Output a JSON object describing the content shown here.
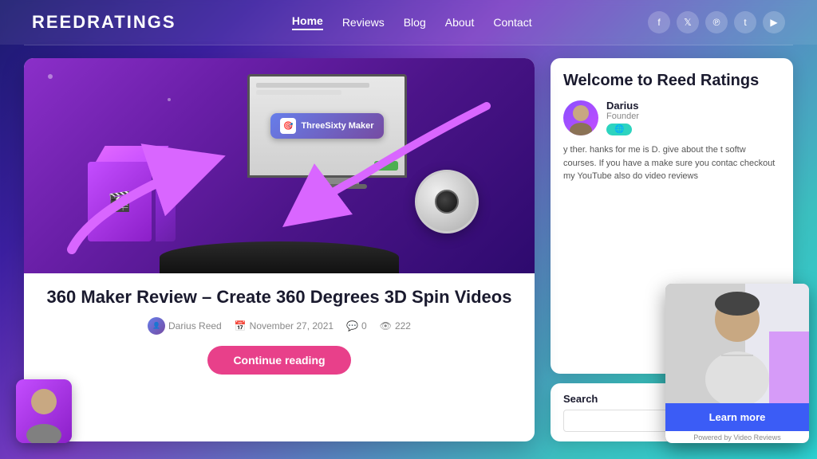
{
  "header": {
    "logo": "ReedRatings",
    "nav": {
      "items": [
        {
          "label": "Home",
          "active": true
        },
        {
          "label": "Reviews",
          "active": false
        },
        {
          "label": "Blog",
          "active": false
        },
        {
          "label": "About",
          "active": false
        },
        {
          "label": "Contact",
          "active": false
        }
      ]
    },
    "social": {
      "icons": [
        "f",
        "t",
        "p",
        "t",
        "yt"
      ]
    }
  },
  "article": {
    "title": "360 Maker Review – Create 360 Degrees 3D Spin Videos",
    "meta": {
      "author": "Darius Reed",
      "date": "November 27, 2021",
      "comments": "0",
      "views": "222"
    },
    "continue_reading": "Continue reading"
  },
  "sidebar": {
    "welcome": {
      "title": "Welcome to Reed Ratings",
      "author_name": "Darius",
      "author_role": "Founder",
      "author_btn": "●",
      "description": "y ther. hanks for me is D. give about the t softw courses. If you have a make sure you contac checkout my YouTube also do video reviews"
    },
    "search": {
      "label": "Search",
      "placeholder": ""
    }
  },
  "video_overlay": {
    "learn_more": "Learn more",
    "footer": "Powered by Video Reviews"
  },
  "app_badge": {
    "name": "ThreeSixty Maker"
  }
}
